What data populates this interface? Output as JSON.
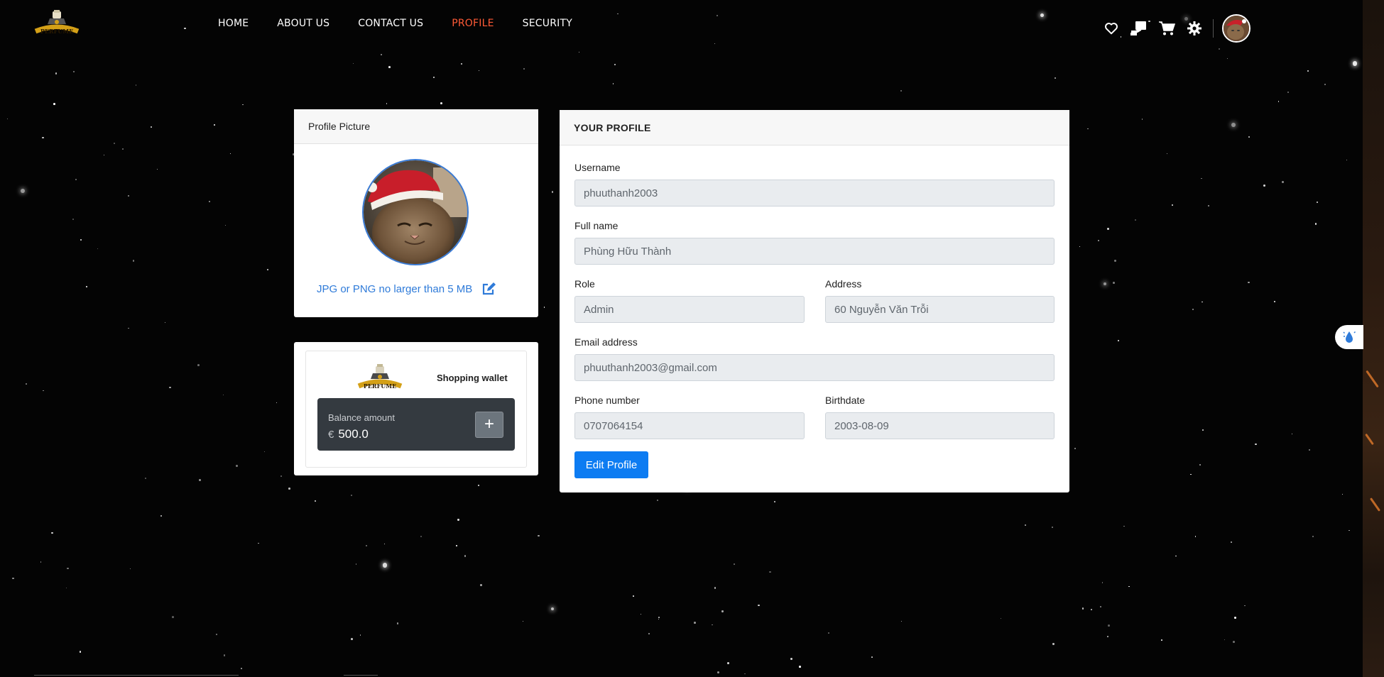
{
  "brand": {
    "logo_text": "PERFUME",
    "accent": "#d4a017"
  },
  "nav": {
    "links": [
      {
        "label": "HOME",
        "active": false
      },
      {
        "label": "ABOUT US",
        "active": false
      },
      {
        "label": "CONTACT US",
        "active": false
      },
      {
        "label": "PROFILE",
        "active": true
      },
      {
        "label": "SECURITY",
        "active": false
      }
    ],
    "active_color": "#ff5a36",
    "icons": [
      "heart-icon",
      "order-icon",
      "cart-icon",
      "gear-icon",
      "user-avatar"
    ]
  },
  "profile_picture": {
    "header": "Profile Picture",
    "hint": "JPG or PNG no larger than 5 MB"
  },
  "wallet": {
    "title": "Shopping wallet",
    "balance_label": "Balance amount",
    "currency": "€",
    "balance": "500.0",
    "add_label": "+"
  },
  "profile": {
    "header": "YOUR PROFILE",
    "username_label": "Username",
    "username": "phuuthanh2003",
    "fullname_label": "Full name",
    "fullname": "Phùng Hữu Thành",
    "role_label": "Role",
    "role": "Admin",
    "address_label": "Address",
    "address": "60 Nguyễn Văn Trỗi",
    "email_label": "Email address",
    "email": "phuuthanh2003@gmail.com",
    "phone_label": "Phone number",
    "phone": "0707064154",
    "birthdate_label": "Birthdate",
    "birthdate": "2003-08-09",
    "edit_button": "Edit Profile"
  }
}
